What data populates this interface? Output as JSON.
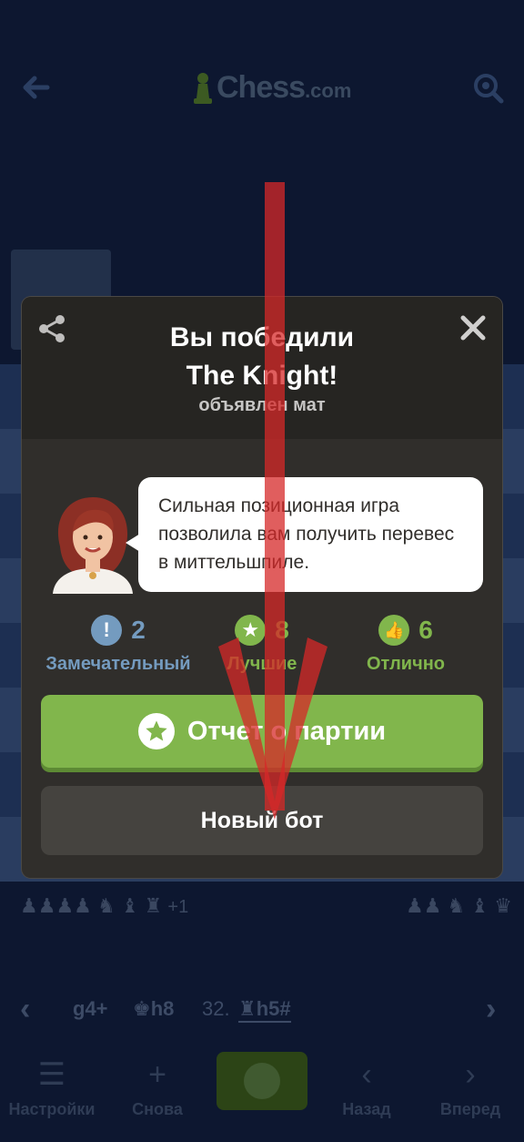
{
  "header": {
    "logo_word": "Chess",
    "logo_domain": ".com"
  },
  "modal": {
    "title_line1": "Вы победили",
    "title_line2": "The Knight!",
    "subtitle": "объявлен мат",
    "coach_message": "Сильная позиционная игра позволила вам получить перевес в миттельшпиле.",
    "stats": [
      {
        "icon": "!",
        "count": "2",
        "label": "Замечательный",
        "color": "#749bbf"
      },
      {
        "icon": "★",
        "count": "8",
        "label": "Лучшие",
        "color": "#81b64c"
      },
      {
        "icon": "👍",
        "count": "6",
        "label": "Отлично",
        "color": "#81b64c"
      }
    ],
    "review_label": "Отчет о партии",
    "new_bot_label": "Новый бот"
  },
  "moves": {
    "m1": "g4+",
    "m2": "♚h8",
    "num": "32.",
    "m3": "♜h5#"
  },
  "captured": {
    "left": "♟♟♟♟ ♞ ♝ ♜",
    "plus": "+1",
    "right": "♟♟ ♞ ♝ ♛"
  },
  "bottom_nav": [
    {
      "icon": "☰",
      "label": "Настройки"
    },
    {
      "icon": "+",
      "label": "Снова"
    },
    {
      "icon": "‹",
      "label": "Назад"
    },
    {
      "icon": "›",
      "label": "Вперед"
    }
  ],
  "colors": {
    "accent_green": "#81b64c",
    "annotation_arrow": "#d62828"
  }
}
